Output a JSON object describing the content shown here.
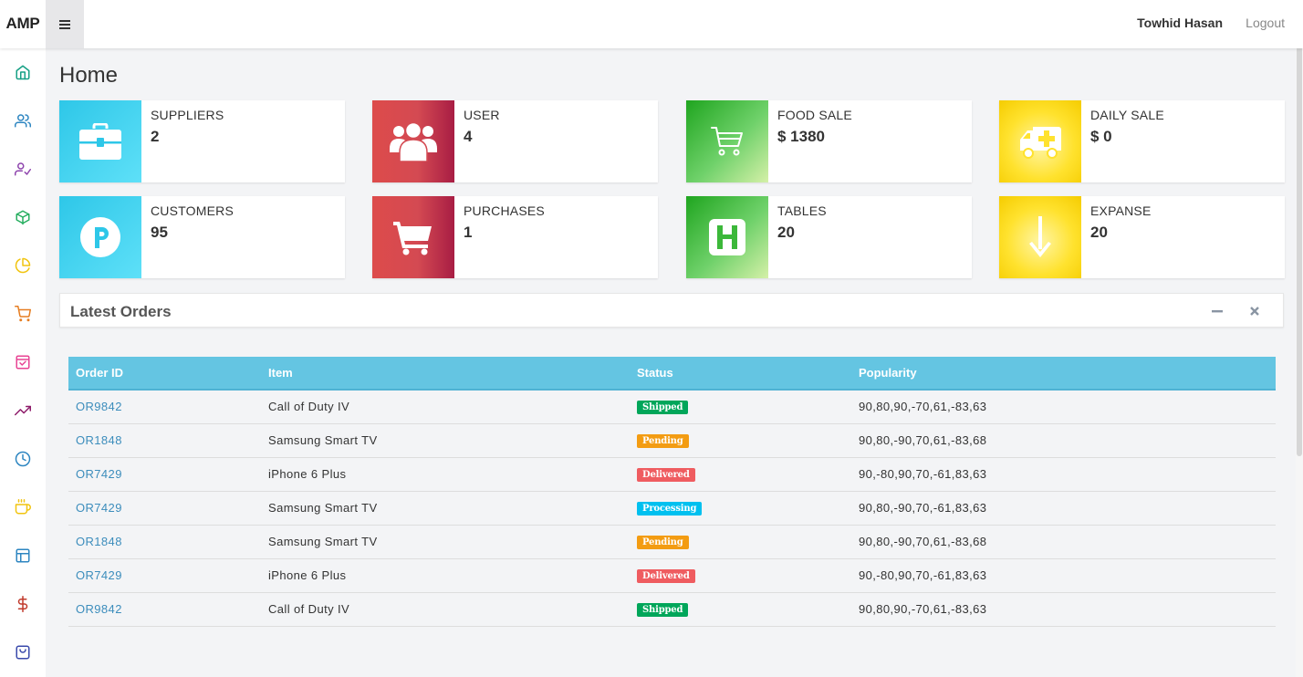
{
  "header": {
    "brand": "AMP",
    "menu_icon": "hamburger-icon",
    "user_name": "Towhid Hasan",
    "logout_label": "Logout"
  },
  "sidebar": {
    "items": [
      {
        "icon": "home-icon",
        "color": "#16a085"
      },
      {
        "icon": "users-icon",
        "color": "#2e86c1"
      },
      {
        "icon": "user-check-icon",
        "color": "#8e44ad"
      },
      {
        "icon": "box-icon",
        "color": "#27ae60"
      },
      {
        "icon": "pie-chart-icon",
        "color": "#f1c40f"
      },
      {
        "icon": "cart-icon",
        "color": "#e67e22"
      },
      {
        "icon": "shopping-bag-icon",
        "color": "#e84393"
      },
      {
        "icon": "trending-up-icon",
        "color": "#8e1c6a"
      },
      {
        "icon": "clock-icon",
        "color": "#2e86c1"
      },
      {
        "icon": "coffee-icon",
        "color": "#f1c40f"
      },
      {
        "icon": "layout-icon",
        "color": "#2e86c1"
      },
      {
        "icon": "dollar-icon",
        "color": "#c0392b"
      },
      {
        "icon": "bag-icon",
        "color": "#3949ab"
      }
    ]
  },
  "page": {
    "title": "Home"
  },
  "cards": [
    {
      "label": "SUPPLIERS",
      "value": "2",
      "icon": "briefcase-icon",
      "color": "cyan"
    },
    {
      "label": "USER",
      "value": "4",
      "icon": "users-group-icon",
      "color": "red"
    },
    {
      "label": "FOOD SALE",
      "value": "$ 1380",
      "icon": "shopping-cart-icon",
      "color": "green"
    },
    {
      "label": "DAILY SALE",
      "value": "$ 0",
      "icon": "ambulance-icon",
      "color": "yellow"
    },
    {
      "label": "CUSTOMERS",
      "value": "95",
      "icon": "parking-icon",
      "color": "cyan"
    },
    {
      "label": "PURCHASES",
      "value": "1",
      "icon": "cart-icon",
      "color": "red"
    },
    {
      "label": "TABLES",
      "value": "20",
      "icon": "hospital-h-icon",
      "color": "green"
    },
    {
      "label": "EXPANSE",
      "value": "20",
      "icon": "arrow-down-icon",
      "color": "yellow"
    }
  ],
  "orders_panel": {
    "title": "Latest Orders",
    "columns": [
      "Order ID",
      "Item",
      "Status",
      "Popularity"
    ],
    "rows": [
      {
        "id": "OR9842",
        "item": "Call of Duty IV",
        "status": "Shipped",
        "status_color": "#00a65a",
        "popularity": "90,80,90,-70,61,-83,63"
      },
      {
        "id": "OR1848",
        "item": "Samsung Smart TV",
        "status": "Pending",
        "status_color": "#f39c12",
        "popularity": "90,80,-90,70,61,-83,68"
      },
      {
        "id": "OR7429",
        "item": "iPhone 6 Plus",
        "status": "Delivered",
        "status_color": "#ef5c60",
        "popularity": "90,-80,90,70,-61,83,63"
      },
      {
        "id": "OR7429",
        "item": "Samsung Smart TV",
        "status": "Processing",
        "status_color": "#00c0ef",
        "popularity": "90,80,-90,70,-61,83,63"
      },
      {
        "id": "OR1848",
        "item": "Samsung Smart TV",
        "status": "Pending",
        "status_color": "#f39c12",
        "popularity": "90,80,-90,70,61,-83,68"
      },
      {
        "id": "OR7429",
        "item": "iPhone 6 Plus",
        "status": "Delivered",
        "status_color": "#ef5c60",
        "popularity": "90,-80,90,70,-61,83,63"
      },
      {
        "id": "OR9842",
        "item": "Call of Duty IV",
        "status": "Shipped",
        "status_color": "#00a65a",
        "popularity": "90,80,90,-70,61,-83,63"
      }
    ]
  }
}
